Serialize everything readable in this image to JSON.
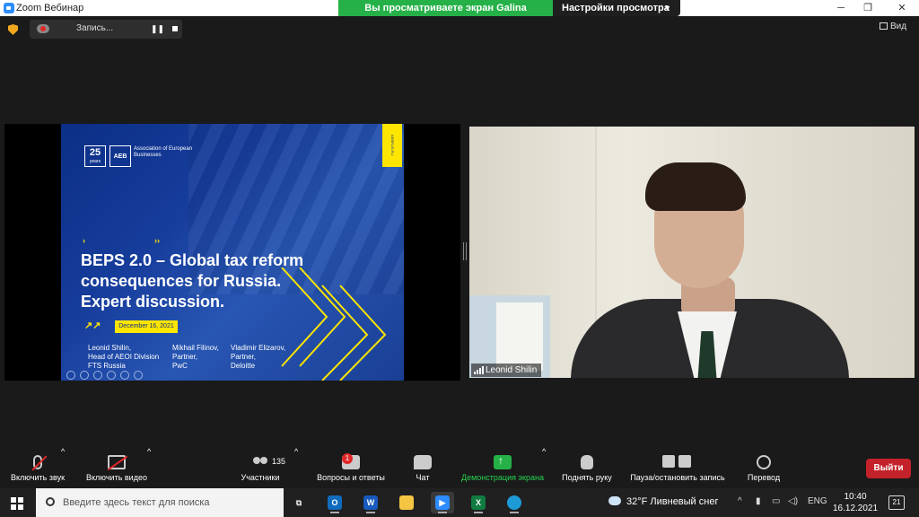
{
  "window": {
    "title": "Zoom Вебинар",
    "share_banner": "Вы просматриваете экран Galina Solomonova",
    "view_options": "Настройки просмотра",
    "minimize": "─",
    "maximize": "❐",
    "close": "✕"
  },
  "topbar": {
    "recording_label": "Запись...",
    "pause": "❚❚",
    "view_label": "Вид"
  },
  "slide": {
    "anniversary": "25",
    "anniversary_sub": "years",
    "org_abbr": "AEB",
    "org_name": "Association of European Businesses",
    "tab_text": "AEBRUS.RU",
    "title_lines": [
      "BEPS 2.0 – Global tax reform",
      "consequences for Russia.",
      "Expert discussion."
    ],
    "date": "December 16,  2021",
    "speakers": [
      {
        "lines": [
          "Leonid Shilin,",
          "Head of AEOI Division",
          "FTS Russia"
        ]
      },
      {
        "lines": [
          "Mikhail Filinov,",
          "Partner,",
          "PwC"
        ]
      },
      {
        "lines": [
          "Vladimir Elizarov,",
          "Partner,",
          "Deloitte"
        ]
      }
    ]
  },
  "video": {
    "participant_name": "Leonid Shilin"
  },
  "toolbar": {
    "audio": "Включить звук",
    "video": "Включить видео",
    "participants": "Участники",
    "participants_count": "135",
    "qa": "Вопросы и ответы",
    "qa_badge": "1",
    "chat": "Чат",
    "share": "Демонстрация экрана",
    "raise_hand": "Поднять руку",
    "record": "Пауза/остановить запись",
    "translate": "Перевод",
    "exit": "Выйти",
    "colors": {
      "share_green": "#25d14f",
      "exit_red": "#c4222a"
    }
  },
  "taskbar": {
    "search_placeholder": "Введите здесь текст для поиска",
    "weather": "32°F  Ливневый снег",
    "language": "ENG",
    "time": "10:40",
    "date": "16.12.2021",
    "notifications": "21"
  }
}
